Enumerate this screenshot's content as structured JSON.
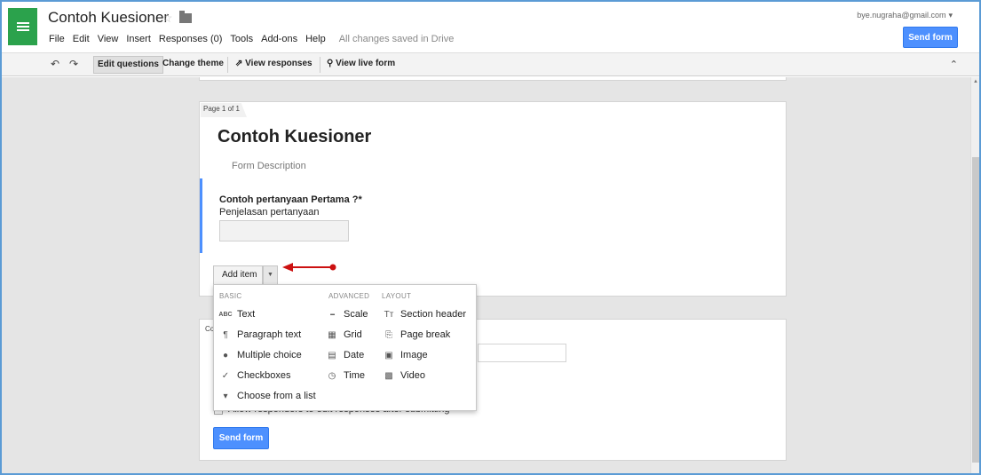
{
  "header": {
    "title": "Contoh Kuesioner",
    "account": "bye.nugraha@gmail.com",
    "account_caret": "▾",
    "send_form_label": "Send form",
    "menu": [
      "File",
      "Edit",
      "View",
      "Insert",
      "Responses (0)",
      "Tools",
      "Add-ons",
      "Help"
    ],
    "save_status": "All changes saved in Drive"
  },
  "toolbar": {
    "edit_questions": "Edit questions",
    "change_theme": "Change theme",
    "view_responses": "View responses",
    "view_live_form": "View live form"
  },
  "form": {
    "page_label": "Page 1 of 1",
    "title": "Contoh Kuesioner",
    "description": "Form Description",
    "question_title": "Contoh pertanyaan Pertama ?",
    "required_mark": "*",
    "question_help": "Penjelasan pertanyaan",
    "add_item_label": "Add item"
  },
  "confirmation": {
    "label": "Co",
    "allow_edit_label": "Allow responders to edit responses after submitting",
    "send_form_label": "Send form"
  },
  "add_item_menu": {
    "headings": [
      "BASIC",
      "ADVANCED",
      "LAYOUT"
    ],
    "basic": [
      {
        "label": "Text",
        "icon": "abc-icon",
        "glyph": "ABC"
      },
      {
        "label": "Paragraph text",
        "icon": "paragraph-icon",
        "glyph": "¶"
      },
      {
        "label": "Multiple choice",
        "icon": "radio-icon",
        "glyph": "●"
      },
      {
        "label": "Checkboxes",
        "icon": "checkmark-icon",
        "glyph": "✓"
      },
      {
        "label": "Choose from a list",
        "icon": "dropdown-icon",
        "glyph": "▾"
      }
    ],
    "advanced": [
      {
        "label": "Scale",
        "icon": "scale-icon",
        "glyph": "━"
      },
      {
        "label": "Grid",
        "icon": "grid-icon",
        "glyph": "▦"
      },
      {
        "label": "Date",
        "icon": "calendar-icon",
        "glyph": "▤"
      },
      {
        "label": "Time",
        "icon": "clock-icon",
        "glyph": "◷"
      }
    ],
    "layout": [
      {
        "label": "Section header",
        "icon": "section-header-icon",
        "glyph": "Tт"
      },
      {
        "label": "Page break",
        "icon": "page-break-icon",
        "glyph": "⎘"
      },
      {
        "label": "Image",
        "icon": "image-icon",
        "glyph": "▣"
      },
      {
        "label": "Video",
        "icon": "video-icon",
        "glyph": "▩"
      }
    ]
  },
  "colors": {
    "accent": "#4d90fe",
    "brand_green": "#2ba24c",
    "annotation_red": "#cc1111"
  }
}
